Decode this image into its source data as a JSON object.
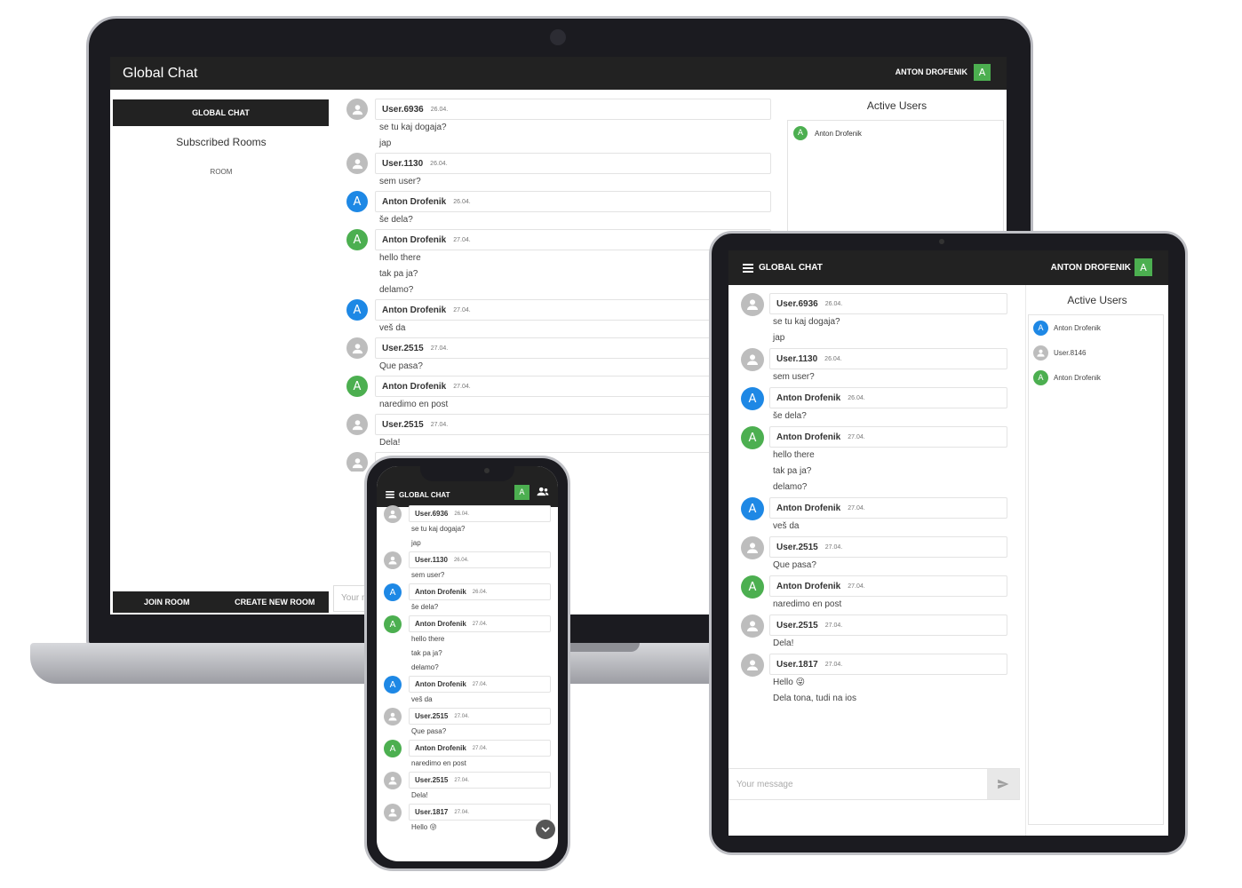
{
  "colors": {
    "dark": "#222222",
    "green": "#4caf50",
    "blue": "#1e88e5",
    "gray": "#bdbdbd"
  },
  "laptop": {
    "title": "Global Chat",
    "user_name": "ANTON DROFENIK",
    "user_initial": "A",
    "global_chat_button": "GLOBAL CHAT",
    "subscribed_rooms": "Subscribed Rooms",
    "room": "ROOM",
    "join_room": "JOIN ROOM",
    "create_new_room": "CREATE NEW ROOM",
    "input_placeholder": "Your m",
    "active_users_title": "Active Users",
    "active_users": [
      {
        "name": "Anton Drofenik",
        "initial": "A",
        "color": "green"
      }
    ],
    "messages": [
      {
        "user": "User.6936",
        "date": "26.04.",
        "avatar": "gray",
        "lines": [
          "se tu kaj dogaja?",
          "jap"
        ]
      },
      {
        "user": "User.1130",
        "date": "26.04.",
        "avatar": "gray",
        "lines": [
          "sem user?"
        ]
      },
      {
        "user": "Anton Drofenik",
        "date": "26.04.",
        "avatar": "blue",
        "initial": "A",
        "lines": [
          "še dela?"
        ]
      },
      {
        "user": "Anton Drofenik",
        "date": "27.04.",
        "avatar": "green",
        "initial": "A",
        "lines": [
          "hello there",
          "tak pa ja?",
          "delamo?"
        ]
      },
      {
        "user": "Anton Drofenik",
        "date": "27.04.",
        "avatar": "blue",
        "initial": "A",
        "lines": [
          "veš da"
        ]
      },
      {
        "user": "User.2515",
        "date": "27.04.",
        "avatar": "gray",
        "lines": [
          "Que pasa?"
        ]
      },
      {
        "user": "Anton Drofenik",
        "date": "27.04.",
        "avatar": "green",
        "initial": "A",
        "lines": [
          "naredimo en post"
        ]
      },
      {
        "user": "User.2515",
        "date": "27.04.",
        "avatar": "gray",
        "lines": [
          "Dela!"
        ]
      },
      {
        "user": "",
        "date": "",
        "avatar": "gray",
        "lines": []
      }
    ]
  },
  "tablet": {
    "title": "GLOBAL CHAT",
    "user_name": "ANTON DROFENIK",
    "user_initial": "A",
    "active_users_title": "Active Users",
    "input_placeholder": "Your message",
    "active_users": [
      {
        "name": "Anton Drofenik",
        "initial": "A",
        "color": "blue"
      },
      {
        "name": "User.8146",
        "initial": "",
        "color": "gray"
      },
      {
        "name": "Anton Drofenik",
        "initial": "A",
        "color": "green"
      }
    ],
    "messages": [
      {
        "user": "User.6936",
        "date": "26.04.",
        "avatar": "gray",
        "lines": [
          "se tu kaj dogaja?",
          "jap"
        ]
      },
      {
        "user": "User.1130",
        "date": "26.04.",
        "avatar": "gray",
        "lines": [
          "sem user?"
        ]
      },
      {
        "user": "Anton Drofenik",
        "date": "26.04.",
        "avatar": "blue",
        "initial": "A",
        "lines": [
          "še dela?"
        ]
      },
      {
        "user": "Anton Drofenik",
        "date": "27.04.",
        "avatar": "green",
        "initial": "A",
        "lines": [
          "hello there",
          "tak pa ja?",
          "delamo?"
        ]
      },
      {
        "user": "Anton Drofenik",
        "date": "27.04.",
        "avatar": "blue",
        "initial": "A",
        "lines": [
          "veš da"
        ]
      },
      {
        "user": "User.2515",
        "date": "27.04.",
        "avatar": "gray",
        "lines": [
          "Que pasa?"
        ]
      },
      {
        "user": "Anton Drofenik",
        "date": "27.04.",
        "avatar": "green",
        "initial": "A",
        "lines": [
          "naredimo en post"
        ]
      },
      {
        "user": "User.2515",
        "date": "27.04.",
        "avatar": "gray",
        "lines": [
          "Dela!"
        ]
      },
      {
        "user": "User.1817",
        "date": "27.04.",
        "avatar": "gray",
        "lines": [
          "Hello 😜",
          "Dela tona, tudi na ios"
        ]
      }
    ]
  },
  "phone": {
    "title": "GLOBAL CHAT",
    "user_initial": "A",
    "messages": [
      {
        "user": "User.6936",
        "date": "26.04.",
        "avatar": "gray",
        "lines": [
          "se tu kaj dogaja?",
          "jap"
        ]
      },
      {
        "user": "User.1130",
        "date": "26.04.",
        "avatar": "gray",
        "lines": [
          "sem user?"
        ]
      },
      {
        "user": "Anton Drofenik",
        "date": "26.04.",
        "avatar": "blue",
        "initial": "A",
        "lines": [
          "še dela?"
        ]
      },
      {
        "user": "Anton Drofenik",
        "date": "27.04.",
        "avatar": "green",
        "initial": "A",
        "lines": [
          "hello there",
          "tak pa ja?",
          "delamo?"
        ]
      },
      {
        "user": "Anton Drofenik",
        "date": "27.04.",
        "avatar": "blue",
        "initial": "A",
        "lines": [
          "veš da"
        ]
      },
      {
        "user": "User.2515",
        "date": "27.04.",
        "avatar": "gray",
        "lines": [
          "Que pasa?"
        ]
      },
      {
        "user": "Anton Drofenik",
        "date": "27.04.",
        "avatar": "green",
        "initial": "A",
        "lines": [
          "naredimo en post"
        ]
      },
      {
        "user": "User.2515",
        "date": "27.04.",
        "avatar": "gray",
        "lines": [
          "Dela!"
        ]
      },
      {
        "user": "User.1817",
        "date": "27.04.",
        "avatar": "gray",
        "lines": [
          "Hello 😜"
        ]
      }
    ]
  }
}
